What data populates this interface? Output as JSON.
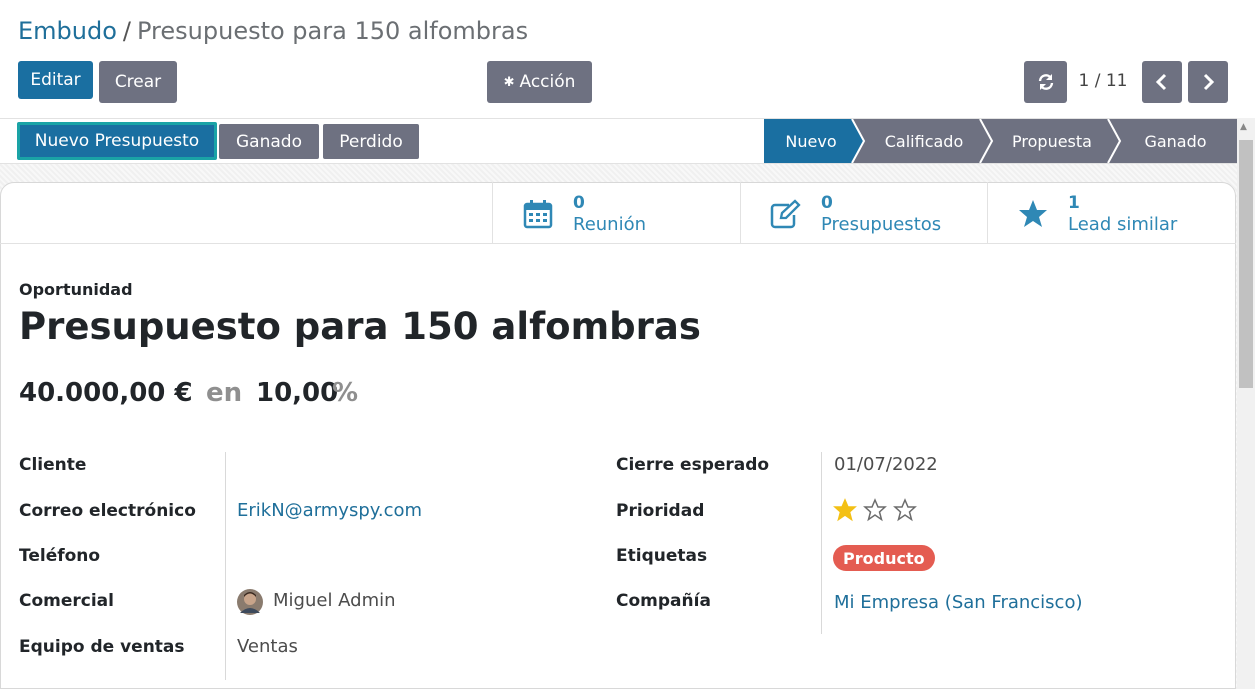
{
  "breadcrumb": {
    "parent": "Embudo",
    "separator": "/",
    "current": "Presupuesto para 150 alfombras"
  },
  "toolbar": {
    "edit": "Editar",
    "create": "Crear",
    "action": "Acción",
    "pager": "1 / 11"
  },
  "statusbar": {
    "buttons": [
      "Nuevo Presupuesto",
      "Ganado",
      "Perdido"
    ],
    "stages": [
      "Nuevo",
      "Calificado",
      "Propuesta",
      "Ganado"
    ],
    "active_stage": "Nuevo"
  },
  "smart_buttons": [
    {
      "count": "0",
      "label": "Reunión",
      "icon": "calendar-icon"
    },
    {
      "count": "0",
      "label": "Presupuestos",
      "icon": "pencil-square-icon"
    },
    {
      "count": "1",
      "label": "Lead similar",
      "icon": "star-icon"
    }
  ],
  "record": {
    "type_label": "Oportunidad",
    "title": "Presupuesto para 150 alfombras",
    "revenue": "40.000,00 €",
    "at": "en",
    "probability": "10,00",
    "percent": "%"
  },
  "left_fields": [
    {
      "label": "Cliente",
      "value": ""
    },
    {
      "label": "Correo electrónico",
      "value": "ErikN@armyspy.com"
    },
    {
      "label": "Teléfono",
      "value": ""
    },
    {
      "label": "Comercial",
      "value": "Miguel Admin"
    },
    {
      "label": "Equipo de ventas",
      "value": "Ventas"
    }
  ],
  "right_fields": [
    {
      "label": "Cierre esperado",
      "value": "01/07/2022"
    },
    {
      "label": "Prioridad",
      "value": 1,
      "max": 3
    },
    {
      "label": "Etiquetas",
      "value": "Producto"
    },
    {
      "label": "Compañía",
      "value": "Mi Empresa (San Francisco)"
    }
  ],
  "colors": {
    "primary": "#1a6fa1",
    "teal": "#1a8f95",
    "stage_active": "#1a6fa1",
    "stage_inactive": "#6e7181",
    "tag": "#e45c51",
    "star": "#f3c015",
    "link": "#1f6f9a"
  }
}
